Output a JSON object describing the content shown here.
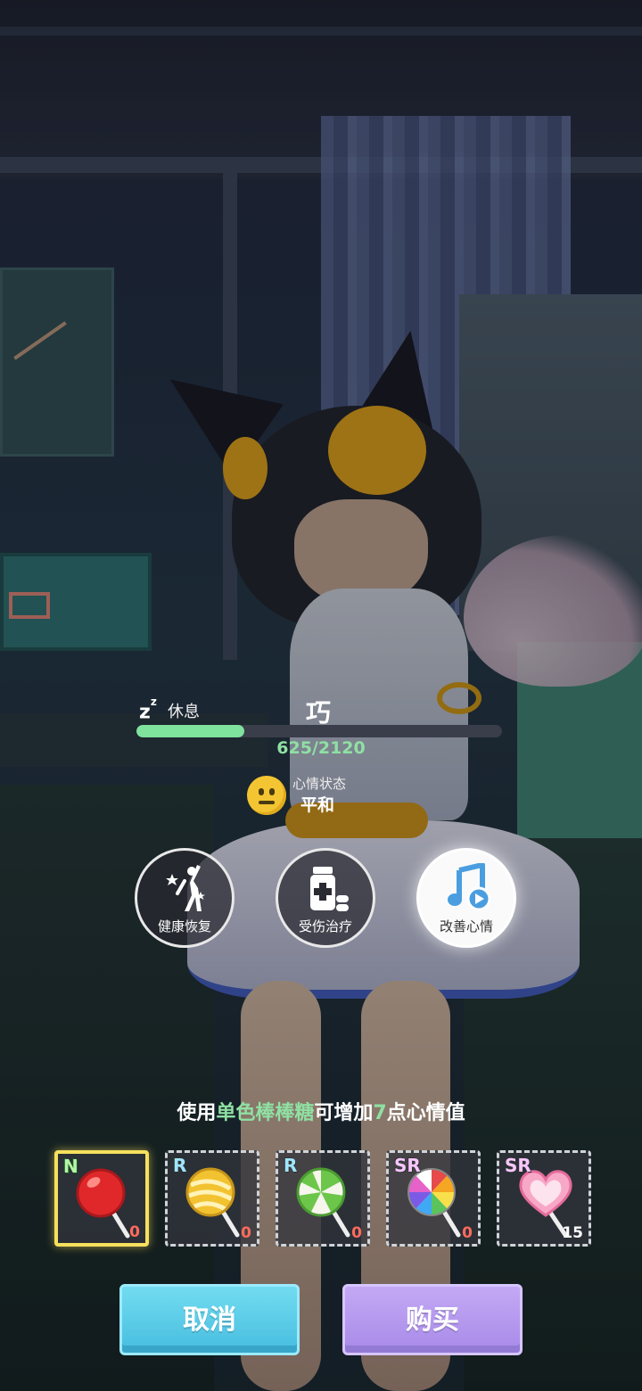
{
  "status": {
    "rest_label": "休息",
    "character_name": "巧",
    "mood_value_text": "625/2120",
    "mood_current": 625,
    "mood_max": 2120,
    "mood_state_label": "心情状态",
    "mood_state_value": "平和"
  },
  "actions": [
    {
      "label": "健康恢复",
      "icon": "exercise-icon"
    },
    {
      "label": "受伤治疗",
      "icon": "medicine-icon"
    },
    {
      "label": "改善心情",
      "icon": "music-icon"
    }
  ],
  "hint": {
    "prefix": "使用",
    "item_name": "单色棒棒糖",
    "middle": "可增加",
    "amount": "7",
    "suffix": "点心情值"
  },
  "candies": [
    {
      "rarity": "N",
      "count": "0",
      "icon": "red-lollipop-icon",
      "selected": true
    },
    {
      "rarity": "R",
      "count": "0",
      "icon": "yellow-swirl-lollipop-icon",
      "selected": false
    },
    {
      "rarity": "R",
      "count": "0",
      "icon": "green-swirl-lollipop-icon",
      "selected": false
    },
    {
      "rarity": "SR",
      "count": "0",
      "icon": "rainbow-lollipop-icon",
      "selected": false
    },
    {
      "rarity": "SR",
      "count": "15",
      "icon": "heart-lollipop-icon",
      "selected": false
    }
  ],
  "buttons": {
    "cancel": "取消",
    "buy": "购买"
  },
  "colors": {
    "mood_bar_fill": "#7fe29d",
    "highlight_text": "#8fe0a3",
    "zero_count": "#ff6b5e",
    "selected_border": "#f6e05e",
    "cancel_button": "#5ccbe8",
    "buy_button": "#b498ee"
  }
}
